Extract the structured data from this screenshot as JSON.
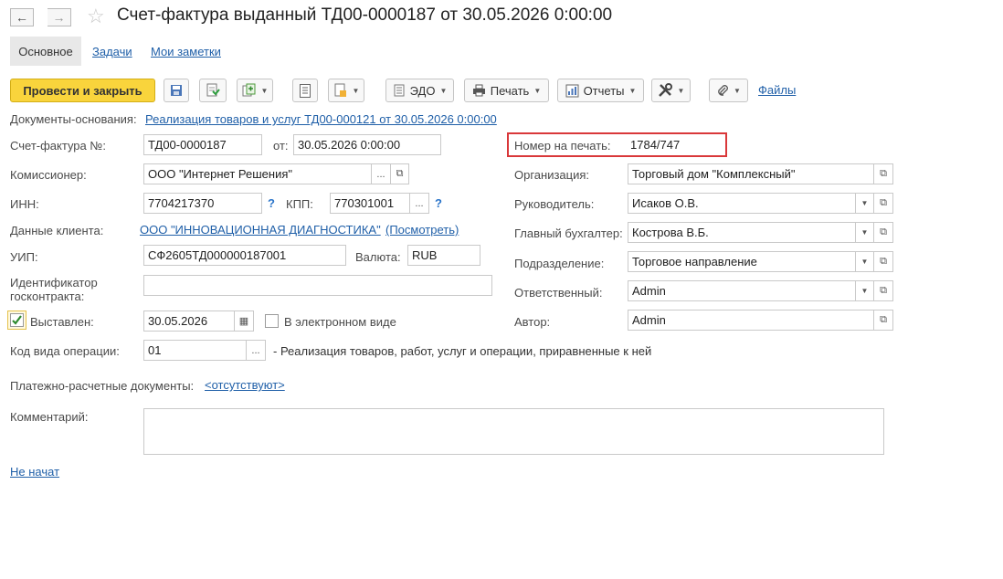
{
  "window": {
    "title": "Счет-фактура выданный ТД00-0000187 от 30.05.2026 0:00:00"
  },
  "tabs": {
    "main": "Основное",
    "tasks": "Задачи",
    "notes": "Мои заметки"
  },
  "toolbar": {
    "post_close": "Провести и закрыть",
    "edo": "ЭДО",
    "print": "Печать",
    "reports": "Отчеты",
    "files": "Файлы"
  },
  "basis": {
    "label": "Документы-основания:",
    "link": "Реализация товаров и услуг ТД00-000121 от 30.05.2026 0:00:00"
  },
  "left": {
    "invoice_no_label": "Счет-фактура №:",
    "invoice_no": "ТД00-0000187",
    "date_label": "от:",
    "date": "30.05.2026  0:00:00",
    "commissioner_label": "Комиссионер:",
    "commissioner": "ООО \"Интернет Решения\"",
    "inn_label": "ИНН:",
    "inn": "7704217370",
    "q": "?",
    "kpp_label": "КПП:",
    "kpp": "770301001",
    "client_label": "Данные клиента:",
    "client_link": "ООО \"ИННОВАЦИОННАЯ ДИАГНОСТИКА\"",
    "client_view": "(Посмотреть)",
    "uip_label": "УИП:",
    "uip": "СФ2605ТД000000187001",
    "currency_label": "Валюта:",
    "currency": "RUB",
    "contract_label_1": "Идентификатор",
    "contract_label_2": "госконтракта:",
    "contract": "",
    "issued_label": "Выставлен:",
    "issued_checked": true,
    "issued_date": "30.05.2026",
    "electronic_label": "В электронном виде",
    "electronic_checked": false,
    "opcode_label": "Код вида операции:",
    "opcode": "01",
    "opcode_desc": "- Реализация товаров, работ, услуг и операции, приравненные к ней",
    "payment_label": "Платежно-расчетные документы:",
    "payment_link": "<отсутствуют>",
    "comment_label": "Комментарий:",
    "comment": "",
    "status_link": "Не начат"
  },
  "right": {
    "print_no_label": "Номер на печать:",
    "print_no": "1784/747",
    "org_label": "Организация:",
    "org": "Торговый дом \"Комплексный\"",
    "head_label": "Руководитель:",
    "head": "Исаков О.В.",
    "accountant_label": "Главный бухгалтер:",
    "accountant": "Кострова В.Б.",
    "division_label": "Подразделение:",
    "division": "Торговое направление",
    "responsible_label": "Ответственный:",
    "responsible": "Admin",
    "author_label": "Автор:",
    "author": "Admin"
  },
  "colors": {
    "accent": "#f9d43c",
    "link": "#1f5fa8",
    "highlight": "#d9383a",
    "checkmark": "#2e8a2e"
  }
}
